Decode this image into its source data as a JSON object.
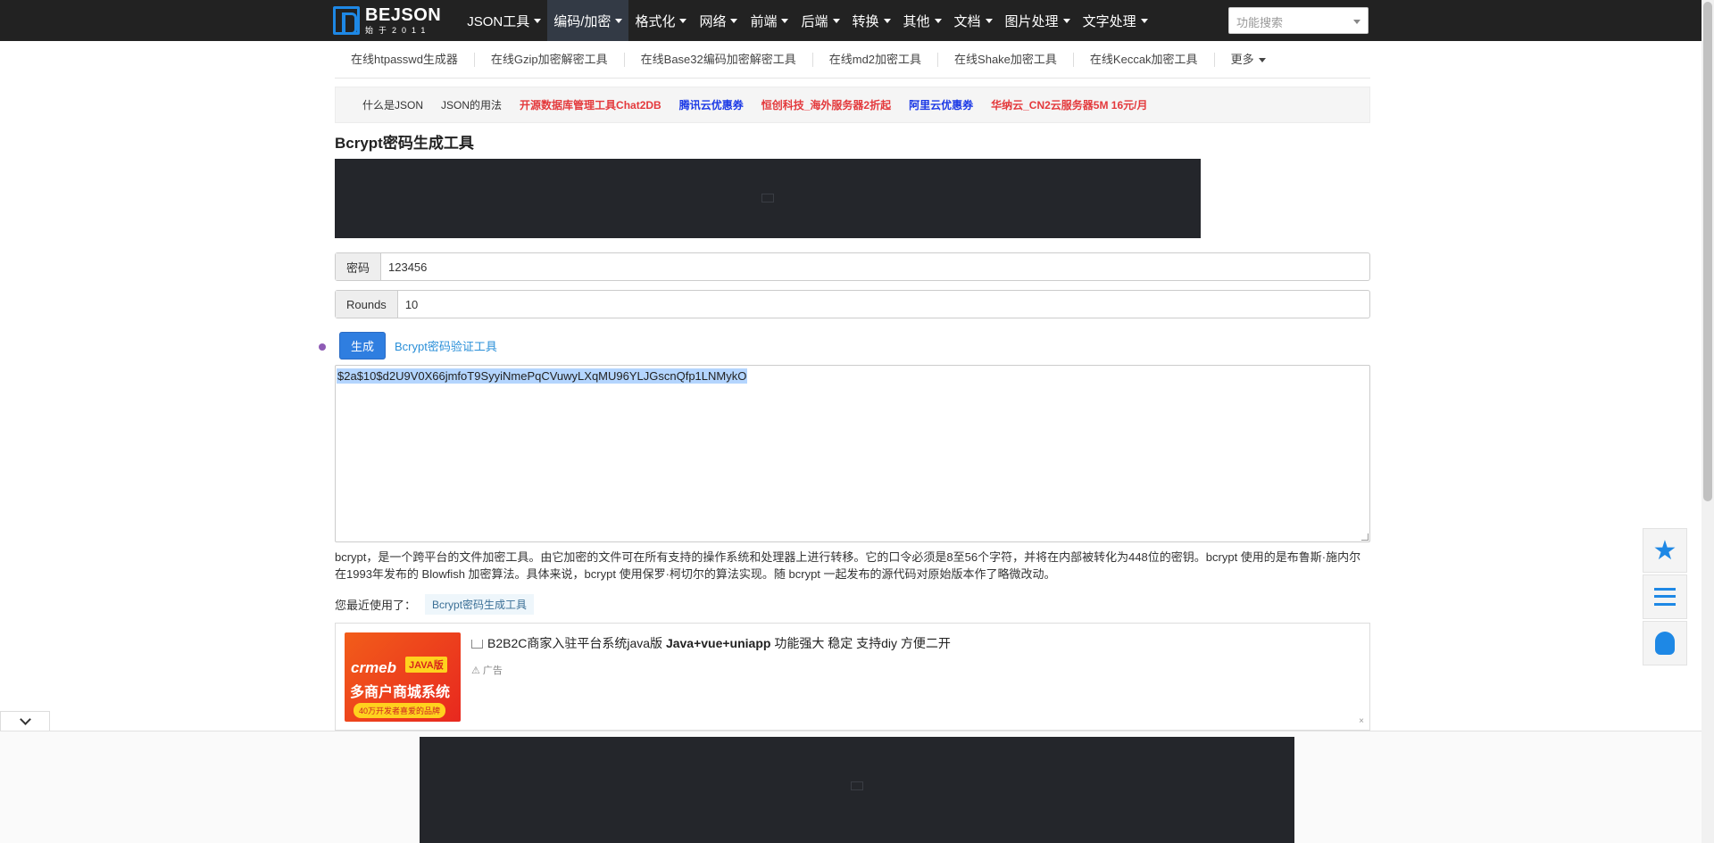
{
  "brand": {
    "title": "BEJSON",
    "sub": "始于2011"
  },
  "nav": [
    {
      "label": "JSON工具",
      "active": false
    },
    {
      "label": "编码/加密",
      "active": true
    },
    {
      "label": "格式化",
      "active": false
    },
    {
      "label": "网络",
      "active": false
    },
    {
      "label": "前端",
      "active": false
    },
    {
      "label": "后端",
      "active": false
    },
    {
      "label": "转换",
      "active": false
    },
    {
      "label": "其他",
      "active": false
    },
    {
      "label": "文档",
      "active": false
    },
    {
      "label": "图片处理",
      "active": false
    },
    {
      "label": "文字处理",
      "active": false
    }
  ],
  "search": {
    "placeholder": "功能搜索"
  },
  "subnav": [
    "在线htpasswd生成器",
    "在线Gzip加密解密工具",
    "在线Base32编码加密解密工具",
    "在线md2加密工具",
    "在线Shake加密工具",
    "在线Keccak加密工具"
  ],
  "subnav_more": "更多",
  "links": [
    {
      "label": "什么是JSON",
      "style": "plain"
    },
    {
      "label": "JSON的用法",
      "style": "plain"
    },
    {
      "label": "开源数据库管理工具Chat2DB",
      "style": "red"
    },
    {
      "label": "腾讯云优惠券",
      "style": "blue"
    },
    {
      "label": "恒创科技_海外服务器2折起",
      "style": "red"
    },
    {
      "label": "阿里云优惠券",
      "style": "blue"
    },
    {
      "label": "华纳云_CN2云服务器5M 16元/月",
      "style": "red"
    }
  ],
  "page_title": "Bcrypt密码生成工具",
  "form": {
    "password_label": "密码",
    "password_value": "123456",
    "rounds_label": "Rounds",
    "rounds_value": "10",
    "generate_label": "生成",
    "verify_link": "Bcrypt密码验证工具",
    "output": "$2a$10$d2U9V0X66jmfoT9SyyiNmePqCVuwyLXqMU96YLJGscnQfp1LNMykO"
  },
  "description": "bcrypt，是一个跨平台的文件加密工具。由它加密的文件可在所有支持的操作系统和处理器上进行转移。它的口令必须是8至56个字符，并将在内部被转化为448位的密钥。bcrypt 使用的是布鲁斯·施内尔在1993年发布的 Blowfish 加密算法。具体来说，bcrypt 使用保罗·柯切尔的算法实现。随 bcrypt 一起发布的源代码对原始版本作了略微改动。",
  "recent": {
    "label": "您最近使用了：",
    "tag": "Bcrypt密码生成工具"
  },
  "ad": {
    "brand": "crmeb",
    "java_badge": "JAVA版",
    "big_text": "多商户商城系统",
    "pill": "40万开发者喜爱的品牌",
    "title_prefix": "B2B2C商家入驻平台系统java版 ",
    "title_bold": "Java+vue+uniapp",
    "title_suffix": " 功能强大 稳定 支持diy 方便二开",
    "label": "广告",
    "close": "×"
  },
  "colors": {
    "accent": "#1e88e5",
    "topbar": "#222222",
    "link_red": "#e4393c",
    "link_blue": "#1b39e6"
  }
}
